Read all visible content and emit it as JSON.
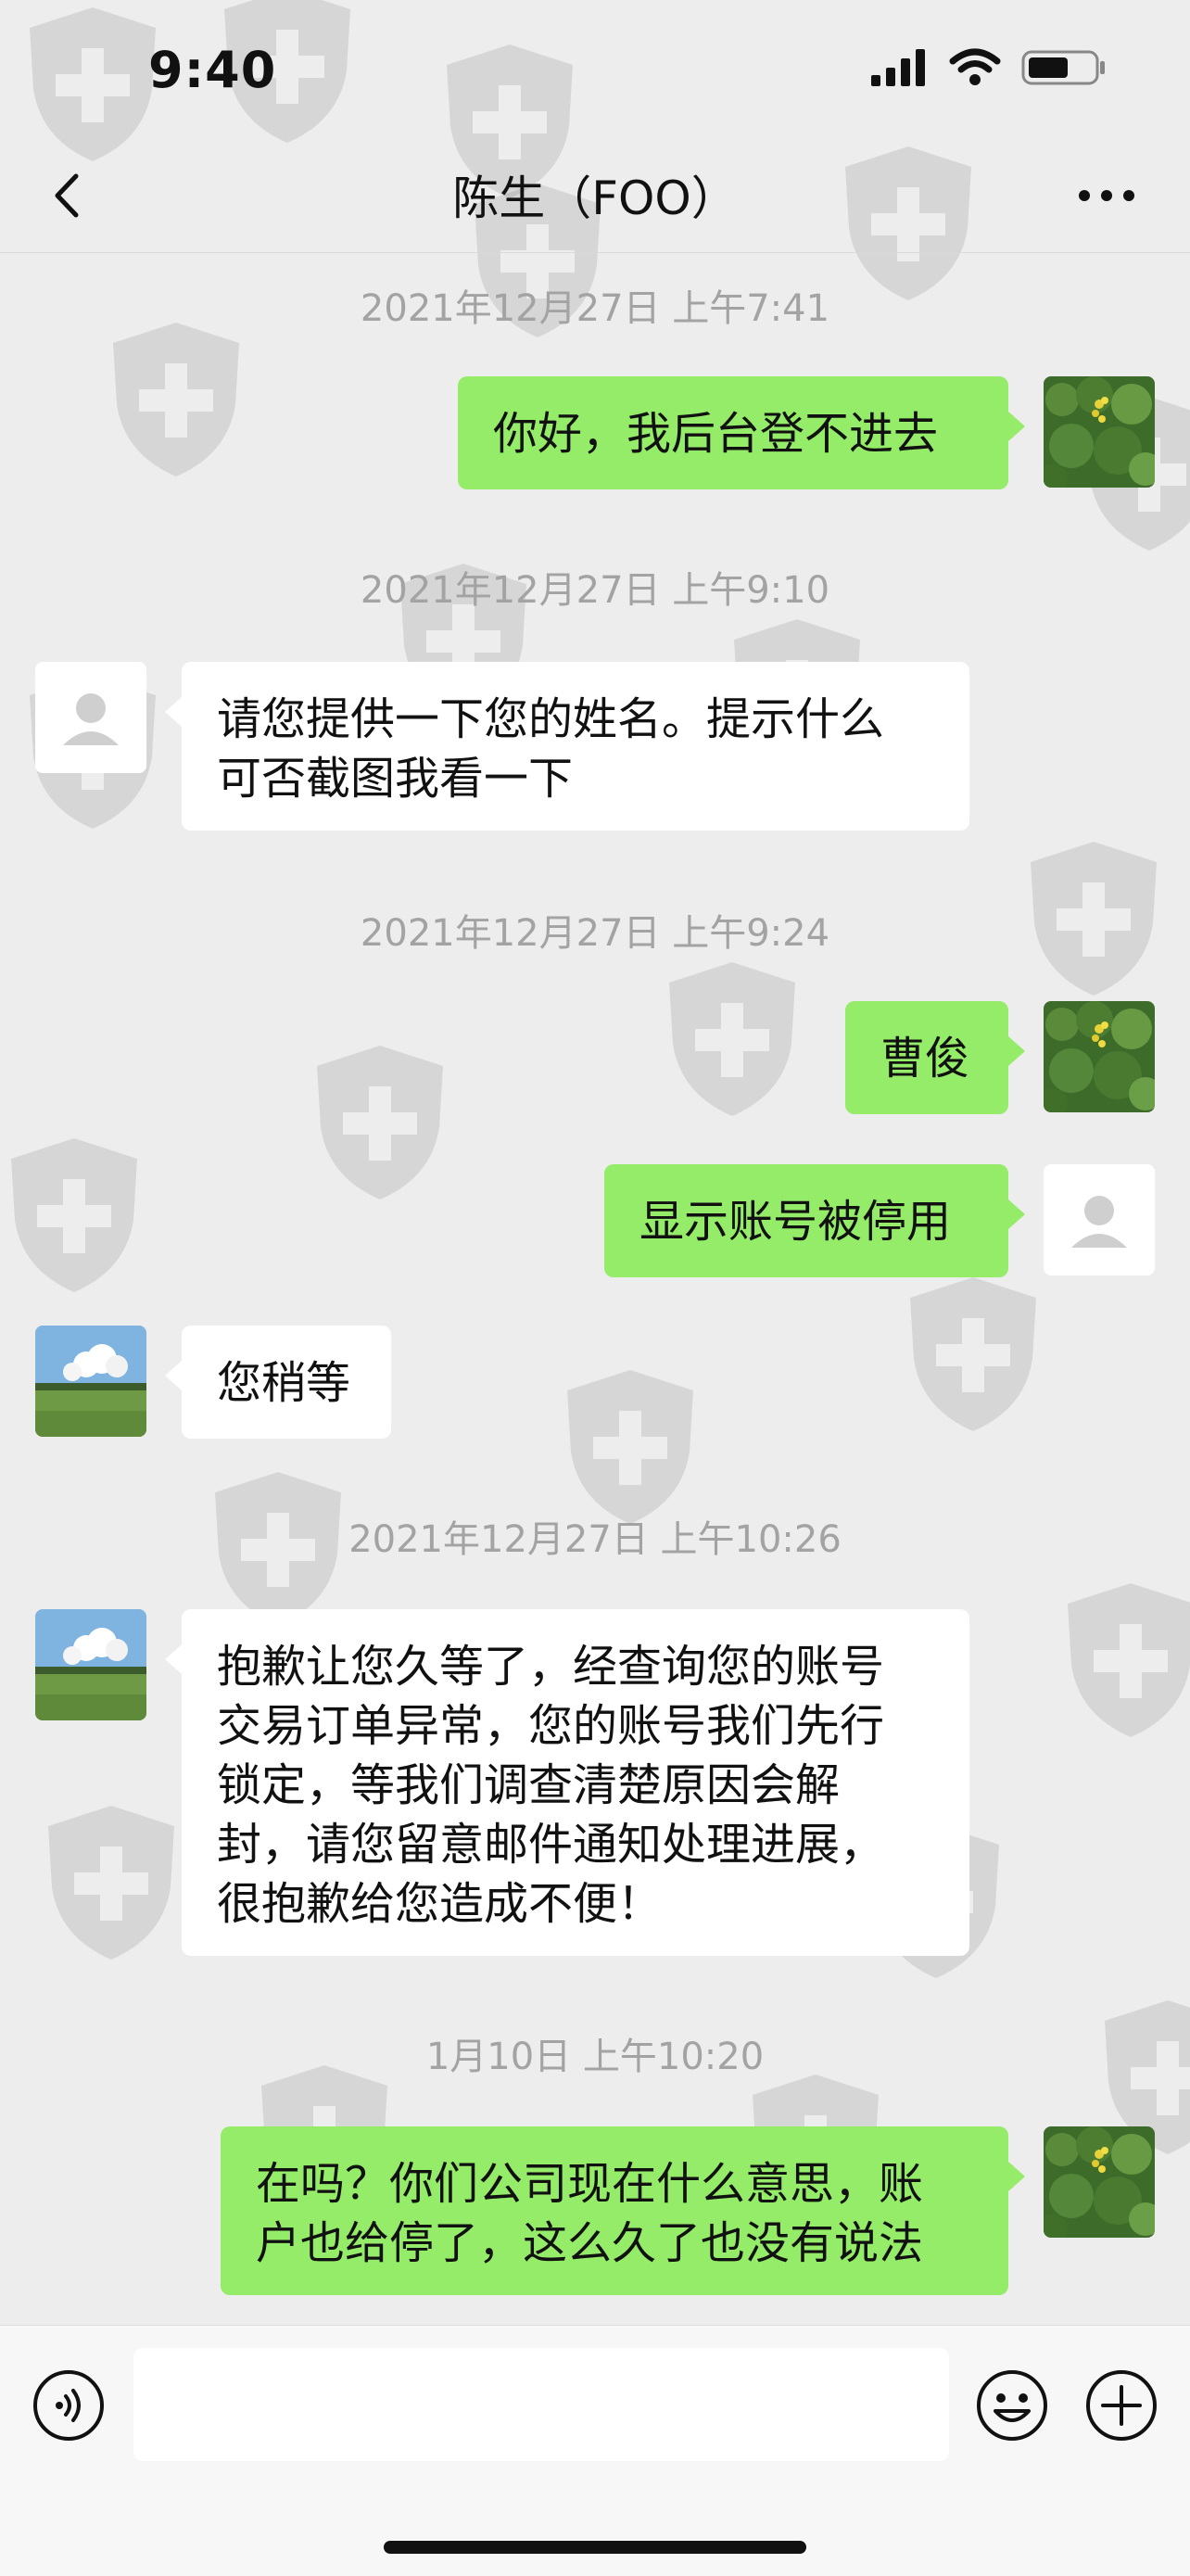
{
  "status_bar": {
    "time": "9:40"
  },
  "header": {
    "title": "陈生（FOO）"
  },
  "messages": [
    {
      "timestamp": "2021年12月27日 上午7:41"
    },
    {
      "side": "me",
      "avatar": "flower-avatar",
      "text": "你好，我后台登不进去"
    },
    {
      "timestamp": "2021年12月27日 上午9:10"
    },
    {
      "side": "them",
      "avatar": "default-avatar",
      "text": "请您提供一下您的姓名。提示什么\n可否截图我看一下"
    },
    {
      "timestamp": "2021年12月27日 上午9:24"
    },
    {
      "side": "me",
      "avatar": "flower-avatar",
      "text": "曹俊"
    },
    {
      "side": "me",
      "avatar": "default-avatar",
      "text": "显示账号被停用"
    },
    {
      "side": "them",
      "avatar": "landscape-avatar",
      "text": "您稍等"
    },
    {
      "timestamp": "2021年12月27日 上午10:26"
    },
    {
      "side": "them",
      "avatar": "landscape-avatar",
      "text": "抱歉让您久等了，经查询您的账号\n交易订单异常，您的账号我们先行\n锁定，等我们调查清楚原因会解\n封，请您留意邮件通知处理进展，\n很抱歉给您造成不便！"
    },
    {
      "timestamp": "1月10日 上午10:20"
    },
    {
      "side": "me",
      "avatar": "flower-avatar",
      "text": "在吗？你们公司现在什么意思，账\n户也给停了，这么久了也没有说法"
    }
  ],
  "input_bar": {
    "placeholder": "",
    "icons": [
      "voice-icon",
      "emoji-icon",
      "plus-icon"
    ]
  },
  "colors": {
    "my_bubble": "#95ec69",
    "their_bubble": "#ffffff",
    "background": "#ededed",
    "timestamp": "#a3a3a3"
  }
}
